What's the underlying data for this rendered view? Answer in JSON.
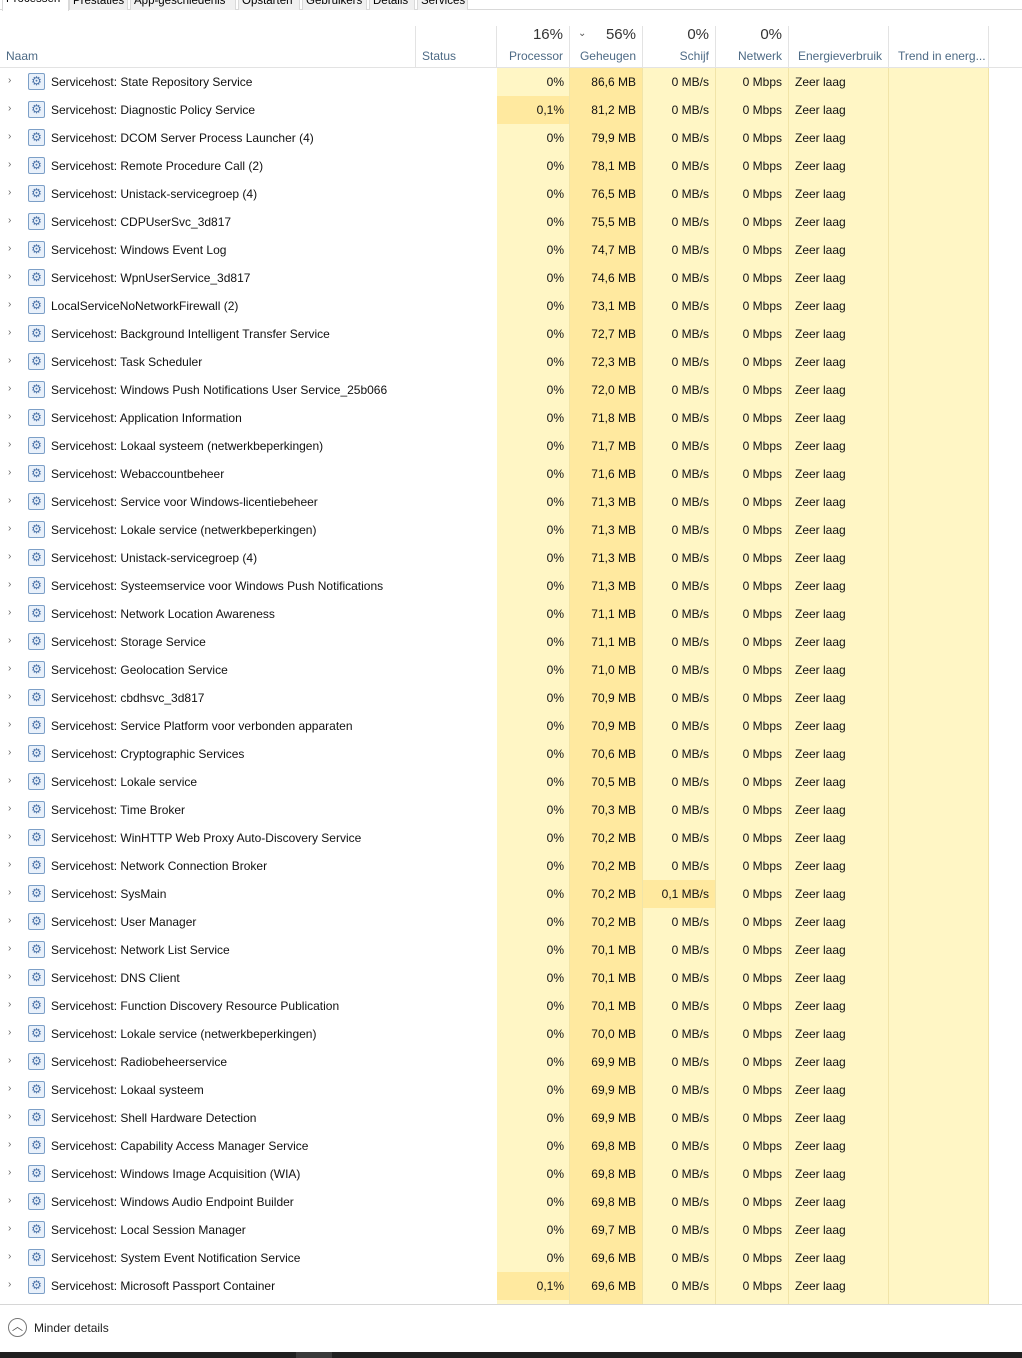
{
  "tabs": [
    "Processen",
    "Prestaties",
    "App-geschiedenis",
    "Opstarten",
    "Gebruikers",
    "Details",
    "Services"
  ],
  "columns": {
    "naam": "Naam",
    "status": "Status",
    "processor": {
      "label": "Processor",
      "pct": "16%"
    },
    "geheugen": {
      "label": "Geheugen",
      "pct": "56%"
    },
    "schijf": {
      "label": "Schijf",
      "pct": "0%"
    },
    "netwerk": {
      "label": "Netwerk",
      "pct": "0%"
    },
    "energie": "Energieverbruik",
    "trend": "Trend in energ..."
  },
  "rows": [
    {
      "name": "Servicehost: State Repository Service",
      "cpu": "0%",
      "mem": "86,6 MB",
      "disk": "0 MB/s",
      "net": "0 Mbps",
      "energy": "Zeer laag"
    },
    {
      "name": "Servicehost: Diagnostic Policy Service",
      "cpu": "0,1%",
      "mem": "81,2 MB",
      "disk": "0 MB/s",
      "net": "0 Mbps",
      "energy": "Zeer laag",
      "cpu_hl": true
    },
    {
      "name": "Servicehost: DCOM Server Process Launcher (4)",
      "cpu": "0%",
      "mem": "79,9 MB",
      "disk": "0 MB/s",
      "net": "0 Mbps",
      "energy": "Zeer laag"
    },
    {
      "name": "Servicehost: Remote Procedure Call (2)",
      "cpu": "0%",
      "mem": "78,1 MB",
      "disk": "0 MB/s",
      "net": "0 Mbps",
      "energy": "Zeer laag"
    },
    {
      "name": "Servicehost: Unistack-servicegroep (4)",
      "cpu": "0%",
      "mem": "76,5 MB",
      "disk": "0 MB/s",
      "net": "0 Mbps",
      "energy": "Zeer laag"
    },
    {
      "name": "Servicehost: CDPUserSvc_3d817",
      "cpu": "0%",
      "mem": "75,5 MB",
      "disk": "0 MB/s",
      "net": "0 Mbps",
      "energy": "Zeer laag"
    },
    {
      "name": "Servicehost: Windows Event Log",
      "cpu": "0%",
      "mem": "74,7 MB",
      "disk": "0 MB/s",
      "net": "0 Mbps",
      "energy": "Zeer laag"
    },
    {
      "name": "Servicehost: WpnUserService_3d817",
      "cpu": "0%",
      "mem": "74,6 MB",
      "disk": "0 MB/s",
      "net": "0 Mbps",
      "energy": "Zeer laag"
    },
    {
      "name": "LocalServiceNoNetworkFirewall (2)",
      "cpu": "0%",
      "mem": "73,1 MB",
      "disk": "0 MB/s",
      "net": "0 Mbps",
      "energy": "Zeer laag"
    },
    {
      "name": "Servicehost: Background Intelligent Transfer Service",
      "cpu": "0%",
      "mem": "72,7 MB",
      "disk": "0 MB/s",
      "net": "0 Mbps",
      "energy": "Zeer laag"
    },
    {
      "name": "Servicehost: Task Scheduler",
      "cpu": "0%",
      "mem": "72,3 MB",
      "disk": "0 MB/s",
      "net": "0 Mbps",
      "energy": "Zeer laag"
    },
    {
      "name": "Servicehost: Windows Push Notifications User Service_25b066",
      "cpu": "0%",
      "mem": "72,0 MB",
      "disk": "0 MB/s",
      "net": "0 Mbps",
      "energy": "Zeer laag"
    },
    {
      "name": "Servicehost: Application Information",
      "cpu": "0%",
      "mem": "71,8 MB",
      "disk": "0 MB/s",
      "net": "0 Mbps",
      "energy": "Zeer laag"
    },
    {
      "name": "Servicehost: Lokaal systeem (netwerkbeperkingen)",
      "cpu": "0%",
      "mem": "71,7 MB",
      "disk": "0 MB/s",
      "net": "0 Mbps",
      "energy": "Zeer laag"
    },
    {
      "name": "Servicehost: Webaccountbeheer",
      "cpu": "0%",
      "mem": "71,6 MB",
      "disk": "0 MB/s",
      "net": "0 Mbps",
      "energy": "Zeer laag"
    },
    {
      "name": "Servicehost: Service voor Windows-licentiebeheer",
      "cpu": "0%",
      "mem": "71,3 MB",
      "disk": "0 MB/s",
      "net": "0 Mbps",
      "energy": "Zeer laag"
    },
    {
      "name": "Servicehost: Lokale service (netwerkbeperkingen)",
      "cpu": "0%",
      "mem": "71,3 MB",
      "disk": "0 MB/s",
      "net": "0 Mbps",
      "energy": "Zeer laag"
    },
    {
      "name": "Servicehost: Unistack-servicegroep (4)",
      "cpu": "0%",
      "mem": "71,3 MB",
      "disk": "0 MB/s",
      "net": "0 Mbps",
      "energy": "Zeer laag"
    },
    {
      "name": "Servicehost: Systeemservice voor Windows Push Notifications",
      "cpu": "0%",
      "mem": "71,3 MB",
      "disk": "0 MB/s",
      "net": "0 Mbps",
      "energy": "Zeer laag"
    },
    {
      "name": "Servicehost: Network Location Awareness",
      "cpu": "0%",
      "mem": "71,1 MB",
      "disk": "0 MB/s",
      "net": "0 Mbps",
      "energy": "Zeer laag"
    },
    {
      "name": "Servicehost: Storage Service",
      "cpu": "0%",
      "mem": "71,1 MB",
      "disk": "0 MB/s",
      "net": "0 Mbps",
      "energy": "Zeer laag"
    },
    {
      "name": "Servicehost: Geolocation Service",
      "cpu": "0%",
      "mem": "71,0 MB",
      "disk": "0 MB/s",
      "net": "0 Mbps",
      "energy": "Zeer laag"
    },
    {
      "name": "Servicehost: cbdhsvc_3d817",
      "cpu": "0%",
      "mem": "70,9 MB",
      "disk": "0 MB/s",
      "net": "0 Mbps",
      "energy": "Zeer laag"
    },
    {
      "name": "Servicehost: Service Platform voor verbonden apparaten",
      "cpu": "0%",
      "mem": "70,9 MB",
      "disk": "0 MB/s",
      "net": "0 Mbps",
      "energy": "Zeer laag"
    },
    {
      "name": "Servicehost: Cryptographic Services",
      "cpu": "0%",
      "mem": "70,6 MB",
      "disk": "0 MB/s",
      "net": "0 Mbps",
      "energy": "Zeer laag"
    },
    {
      "name": "Servicehost: Lokale service",
      "cpu": "0%",
      "mem": "70,5 MB",
      "disk": "0 MB/s",
      "net": "0 Mbps",
      "energy": "Zeer laag"
    },
    {
      "name": "Servicehost: Time Broker",
      "cpu": "0%",
      "mem": "70,3 MB",
      "disk": "0 MB/s",
      "net": "0 Mbps",
      "energy": "Zeer laag"
    },
    {
      "name": "Servicehost: WinHTTP Web Proxy Auto-Discovery Service",
      "cpu": "0%",
      "mem": "70,2 MB",
      "disk": "0 MB/s",
      "net": "0 Mbps",
      "energy": "Zeer laag"
    },
    {
      "name": "Servicehost: Network Connection Broker",
      "cpu": "0%",
      "mem": "70,2 MB",
      "disk": "0 MB/s",
      "net": "0 Mbps",
      "energy": "Zeer laag"
    },
    {
      "name": "Servicehost: SysMain",
      "cpu": "0%",
      "mem": "70,2 MB",
      "disk": "0,1 MB/s",
      "net": "0 Mbps",
      "energy": "Zeer laag",
      "disk_hl": true
    },
    {
      "name": "Servicehost: User Manager",
      "cpu": "0%",
      "mem": "70,2 MB",
      "disk": "0 MB/s",
      "net": "0 Mbps",
      "energy": "Zeer laag"
    },
    {
      "name": "Servicehost: Network List Service",
      "cpu": "0%",
      "mem": "70,1 MB",
      "disk": "0 MB/s",
      "net": "0 Mbps",
      "energy": "Zeer laag"
    },
    {
      "name": "Servicehost: DNS Client",
      "cpu": "0%",
      "mem": "70,1 MB",
      "disk": "0 MB/s",
      "net": "0 Mbps",
      "energy": "Zeer laag"
    },
    {
      "name": "Servicehost: Function Discovery Resource Publication",
      "cpu": "0%",
      "mem": "70,1 MB",
      "disk": "0 MB/s",
      "net": "0 Mbps",
      "energy": "Zeer laag"
    },
    {
      "name": "Servicehost: Lokale service (netwerkbeperkingen)",
      "cpu": "0%",
      "mem": "70,0 MB",
      "disk": "0 MB/s",
      "net": "0 Mbps",
      "energy": "Zeer laag"
    },
    {
      "name": "Servicehost: Radiobeheerservice",
      "cpu": "0%",
      "mem": "69,9 MB",
      "disk": "0 MB/s",
      "net": "0 Mbps",
      "energy": "Zeer laag"
    },
    {
      "name": "Servicehost: Lokaal systeem",
      "cpu": "0%",
      "mem": "69,9 MB",
      "disk": "0 MB/s",
      "net": "0 Mbps",
      "energy": "Zeer laag"
    },
    {
      "name": "Servicehost: Shell Hardware Detection",
      "cpu": "0%",
      "mem": "69,9 MB",
      "disk": "0 MB/s",
      "net": "0 Mbps",
      "energy": "Zeer laag"
    },
    {
      "name": "Servicehost: Capability Access Manager Service",
      "cpu": "0%",
      "mem": "69,8 MB",
      "disk": "0 MB/s",
      "net": "0 Mbps",
      "energy": "Zeer laag"
    },
    {
      "name": "Servicehost: Windows Image Acquisition (WIA)",
      "cpu": "0%",
      "mem": "69,8 MB",
      "disk": "0 MB/s",
      "net": "0 Mbps",
      "energy": "Zeer laag"
    },
    {
      "name": "Servicehost: Windows Audio Endpoint Builder",
      "cpu": "0%",
      "mem": "69,8 MB",
      "disk": "0 MB/s",
      "net": "0 Mbps",
      "energy": "Zeer laag"
    },
    {
      "name": "Servicehost: Local Session Manager",
      "cpu": "0%",
      "mem": "69,7 MB",
      "disk": "0 MB/s",
      "net": "0 Mbps",
      "energy": "Zeer laag"
    },
    {
      "name": "Servicehost: System Event Notification Service",
      "cpu": "0%",
      "mem": "69,6 MB",
      "disk": "0 MB/s",
      "net": "0 Mbps",
      "energy": "Zeer laag"
    },
    {
      "name": "Servicehost: Microsoft Passport Container",
      "cpu": "0,1%",
      "mem": "69,6 MB",
      "disk": "0 MB/s",
      "net": "0 Mbps",
      "energy": "Zeer laag",
      "cpu_hl": true
    }
  ],
  "footer": {
    "label": "Minder details"
  },
  "icons": {
    "expand": "chevron-right-icon",
    "process": "gear-icon",
    "collapse": "chevron-up-circle-icon",
    "sort": "sort-down-arrow-icon"
  },
  "colors": {
    "heat_light": "#fff6c5",
    "heat_medium": "#ffe99f",
    "header_label": "#4d6a85"
  }
}
